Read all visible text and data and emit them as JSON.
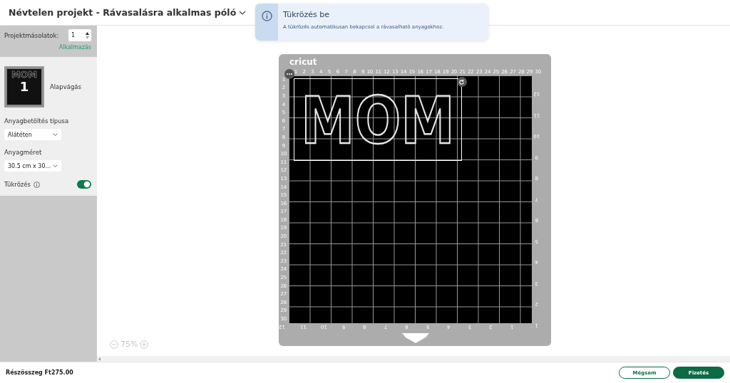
{
  "header": {
    "title": "Névtelen projekt - Rávasalásra alkalmas póló"
  },
  "notification": {
    "title": "Tükrözés be",
    "message": "A tükrözés automatikusan bekapcsol a rávasalható anyagokhoz."
  },
  "sidebar": {
    "copies": {
      "label": "Projektmásolatok:",
      "value": "1"
    },
    "apply_link": "Alkalmazás",
    "mat_preview": {
      "design_text": "MOM",
      "mat_number": "1",
      "label": "Alapvágás"
    },
    "load_type": {
      "label": "Anyagbetöltés típusa",
      "value": "Alátéten"
    },
    "material_size": {
      "label": "Anyagméret",
      "value": "30.5 cm x 30..."
    },
    "mirror": {
      "label": "Tükrözés",
      "on": true
    }
  },
  "mat": {
    "brand": "cricut",
    "design_text": "MOM",
    "top_ruler": [
      "1",
      "2",
      "3",
      "4",
      "5",
      "6",
      "7",
      "8",
      "9",
      "10",
      "11",
      "12",
      "13",
      "14",
      "15",
      "16",
      "17",
      "18",
      "19",
      "20",
      "21",
      "22",
      "23",
      "24",
      "25",
      "26",
      "27",
      "28",
      "29",
      "30"
    ],
    "left_ruler": [
      "1",
      "2",
      "3",
      "4",
      "5",
      "6",
      "7",
      "8",
      "9",
      "10",
      "11",
      "12",
      "13",
      "14",
      "15",
      "16",
      "17",
      "18",
      "19",
      "20",
      "21",
      "22",
      "23",
      "24",
      "25",
      "26",
      "27",
      "28",
      "29",
      "30"
    ],
    "right_ruler": [
      "12",
      "11",
      "10",
      "9",
      "8",
      "7",
      "6",
      "5",
      "4",
      "3",
      "2",
      "1"
    ],
    "bottom_ruler": [
      "12",
      "11",
      "10",
      "9",
      "8",
      "7",
      "6",
      "5",
      "4",
      "3",
      "2",
      "1"
    ]
  },
  "zoom": {
    "value": "75%"
  },
  "footer": {
    "subtotal": "Részösszeg Ft275.00",
    "buttons": [
      {
        "label": "Mégsem",
        "kind": "secondary"
      },
      {
        "label": "Fizetés",
        "kind": "primary"
      }
    ]
  }
}
